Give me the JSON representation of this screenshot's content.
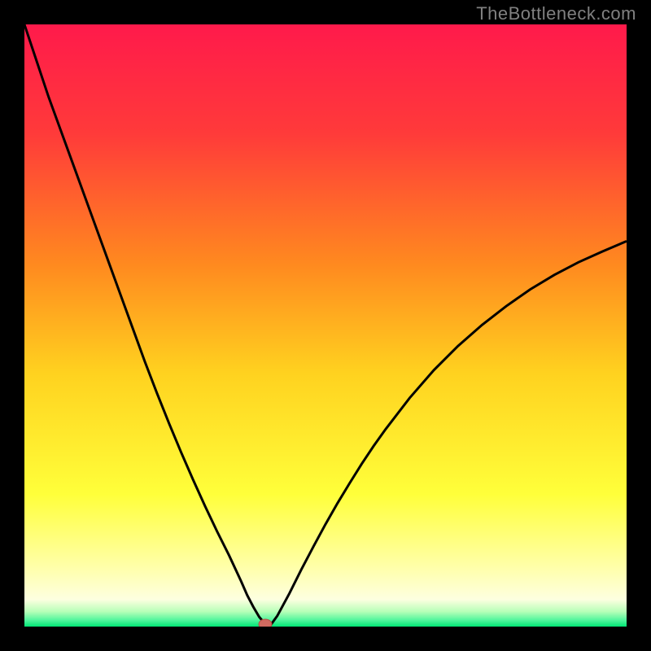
{
  "watermark": "TheBottleneck.com",
  "colors": {
    "frame": "#000000",
    "curve": "#000000",
    "marker_fill": "#d06a60",
    "marker_stroke": "#b84e44"
  },
  "gradient_stops": [
    {
      "offset": 0.0,
      "color": "#ff1a4b"
    },
    {
      "offset": 0.18,
      "color": "#ff3a3a"
    },
    {
      "offset": 0.4,
      "color": "#ff8a1f"
    },
    {
      "offset": 0.58,
      "color": "#ffd21f"
    },
    {
      "offset": 0.78,
      "color": "#ffff3a"
    },
    {
      "offset": 0.9,
      "color": "#ffffa8"
    },
    {
      "offset": 0.955,
      "color": "#fdffe0"
    },
    {
      "offset": 0.975,
      "color": "#b8ffb8"
    },
    {
      "offset": 0.99,
      "color": "#4cf59b"
    },
    {
      "offset": 1.0,
      "color": "#00e676"
    }
  ],
  "chart_data": {
    "type": "line",
    "title": "",
    "xlabel": "",
    "ylabel": "",
    "xlim": [
      0,
      100
    ],
    "ylim": [
      0,
      100
    ],
    "optimum_x": 40,
    "x": [
      0,
      2,
      4,
      6,
      8,
      10,
      12,
      14,
      16,
      18,
      20,
      22,
      24,
      26,
      28,
      30,
      32,
      34,
      36,
      37,
      38,
      39,
      40,
      41,
      42,
      44,
      46,
      48,
      50,
      52,
      54,
      56,
      58,
      60,
      64,
      68,
      72,
      76,
      80,
      84,
      88,
      92,
      96,
      100
    ],
    "values": [
      100,
      94,
      88,
      82.5,
      77,
      71.5,
      66,
      60.5,
      55,
      49.5,
      44,
      38.8,
      33.8,
      29,
      24.4,
      20,
      15.8,
      11.8,
      7.5,
      5.2,
      3.3,
      1.6,
      0.4,
      0.4,
      1.8,
      5.5,
      9.5,
      13.3,
      17,
      20.5,
      23.8,
      27,
      30,
      32.8,
      38,
      42.6,
      46.6,
      50.1,
      53.2,
      56,
      58.4,
      60.5,
      62.3,
      64
    ],
    "marker": {
      "x": 40,
      "y": 0.4
    }
  }
}
